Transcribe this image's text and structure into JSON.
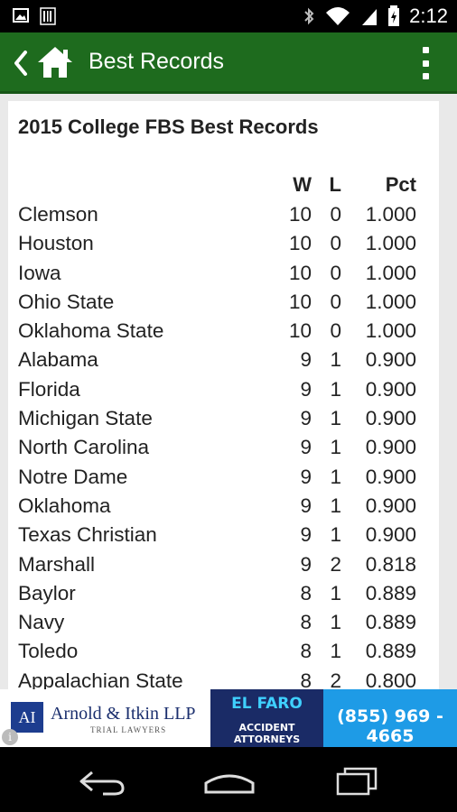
{
  "status_bar": {
    "time": "2:12",
    "icons": [
      "image-icon",
      "barcode-icon",
      "bluetooth-icon",
      "wifi-icon",
      "signal-icon",
      "battery-icon"
    ]
  },
  "app_bar": {
    "title": "Best Records",
    "icons": [
      "back-arrow-icon",
      "home-icon",
      "overflow-menu-icon"
    ],
    "color": "#1e6b1e"
  },
  "page": {
    "title": "2015 College FBS Best Records"
  },
  "table": {
    "headers": {
      "team": "",
      "w": "W",
      "l": "L",
      "pct": "Pct"
    },
    "rows": [
      {
        "team": "Clemson",
        "w": "10",
        "l": "0",
        "pct": "1.000"
      },
      {
        "team": "Houston",
        "w": "10",
        "l": "0",
        "pct": "1.000"
      },
      {
        "team": "Iowa",
        "w": "10",
        "l": "0",
        "pct": "1.000"
      },
      {
        "team": "Ohio State",
        "w": "10",
        "l": "0",
        "pct": "1.000"
      },
      {
        "team": "Oklahoma State",
        "w": "10",
        "l": "0",
        "pct": "1.000"
      },
      {
        "team": "Alabama",
        "w": "9",
        "l": "1",
        "pct": "0.900"
      },
      {
        "team": "Florida",
        "w": "9",
        "l": "1",
        "pct": "0.900"
      },
      {
        "team": "Michigan State",
        "w": "9",
        "l": "1",
        "pct": "0.900"
      },
      {
        "team": "North Carolina",
        "w": "9",
        "l": "1",
        "pct": "0.900"
      },
      {
        "team": "Notre Dame",
        "w": "9",
        "l": "1",
        "pct": "0.900"
      },
      {
        "team": "Oklahoma",
        "w": "9",
        "l": "1",
        "pct": "0.900"
      },
      {
        "team": "Texas Christian",
        "w": "9",
        "l": "1",
        "pct": "0.900"
      },
      {
        "team": "Marshall",
        "w": "9",
        "l": "2",
        "pct": "0.818"
      },
      {
        "team": "Baylor",
        "w": "8",
        "l": "1",
        "pct": "0.889"
      },
      {
        "team": "Navy",
        "w": "8",
        "l": "1",
        "pct": "0.889"
      },
      {
        "team": "Toledo",
        "w": "8",
        "l": "1",
        "pct": "0.889"
      },
      {
        "team": "Appalachian State",
        "w": "8",
        "l": "2",
        "pct": "0.800"
      }
    ]
  },
  "ad": {
    "logo_text": "AI",
    "firm_name": "Arnold & Itkin LLP",
    "firm_sub": "TRIAL LAWYERS",
    "info_icon": "i",
    "brand": "EL FARO",
    "tagline": "ACCIDENT ATTORNEYS",
    "phone": "(855) 969 - 4665"
  },
  "nav_bar": {
    "icons": [
      "back-icon",
      "home-nav-icon",
      "recent-apps-icon"
    ]
  }
}
